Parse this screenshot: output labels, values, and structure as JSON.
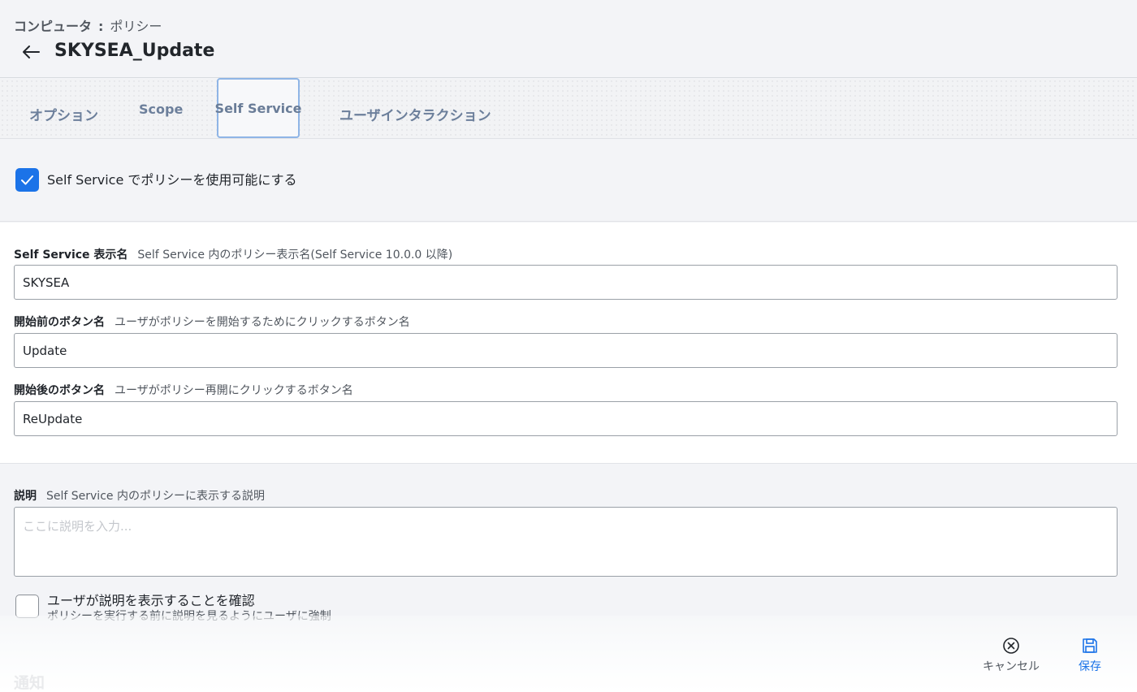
{
  "header": {
    "breadcrumb_section": "コンピュータ",
    "breadcrumb_separator": ":",
    "breadcrumb_page": "ポリシー",
    "title": "SKYSEA_Update"
  },
  "tabs": [
    {
      "label": "オプション",
      "active": false
    },
    {
      "label": "Scope",
      "active": false
    },
    {
      "label": "Self Service",
      "active": true
    },
    {
      "label": "ユーザインタラクション",
      "active": false
    }
  ],
  "enable_self_service": {
    "label": "Self Service でポリシーを使用可能にする",
    "checked": true
  },
  "fields": {
    "display_name": {
      "label": "Self Service 表示名",
      "hint": "Self Service 内のポリシー表示名(Self Service 10.0.0 以降)",
      "value": "SKYSEA"
    },
    "button_before": {
      "label": "開始前のボタン名",
      "hint": "ユーザがポリシーを開始するためにクリックするボタン名",
      "value": "Update"
    },
    "button_after": {
      "label": "開始後のボタン名",
      "hint": "ユーザがポリシー再開にクリックするボタン名",
      "value": "ReUpdate"
    },
    "description": {
      "label": "説明",
      "hint": "Self Service 内のポリシーに表示する説明",
      "value": "",
      "placeholder": "ここに説明を入力..."
    }
  },
  "confirm_description": {
    "label": "ユーザが説明を表示することを確認",
    "hint": "ポリシーを実行する前に説明を見るようにユーザに強制",
    "checked": false
  },
  "notifications_label": "通知",
  "actions": {
    "cancel_label": "キャンセル",
    "save_label": "保存"
  },
  "colors": {
    "accent": "#1b73e8",
    "tab_text": "#6c7f9b",
    "active_tab_border": "#8fb5e6"
  }
}
